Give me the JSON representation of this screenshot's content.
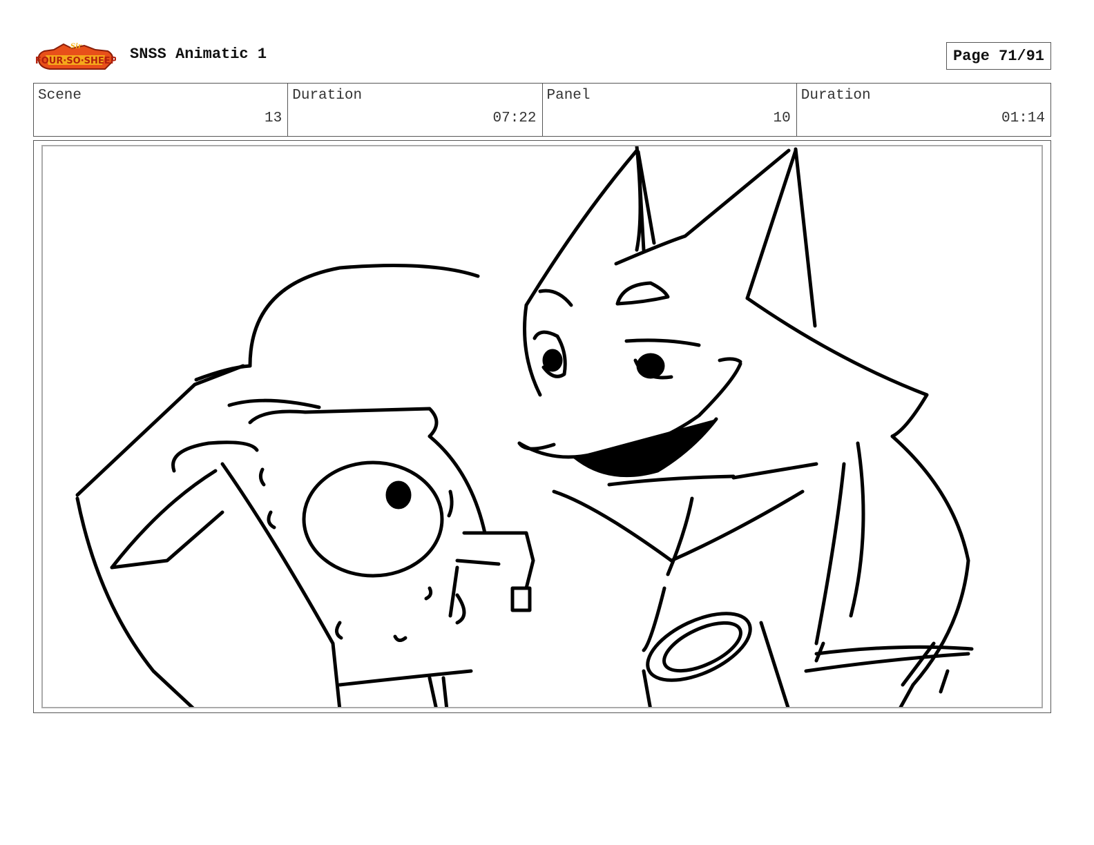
{
  "header": {
    "logo_text": "Sir Four-So-Sheep",
    "project_title": "SNSS Animatic 1",
    "page_indicator": "Page 71/91"
  },
  "info": [
    {
      "label": "Scene",
      "value": "13"
    },
    {
      "label": "Duration",
      "value": "07:22"
    },
    {
      "label": "Panel",
      "value": "10"
    },
    {
      "label": "Duration",
      "value": "01:14"
    }
  ],
  "panel": {
    "drawing_subject": "rough sketch: grinning fox leaning over a sweating small character"
  }
}
